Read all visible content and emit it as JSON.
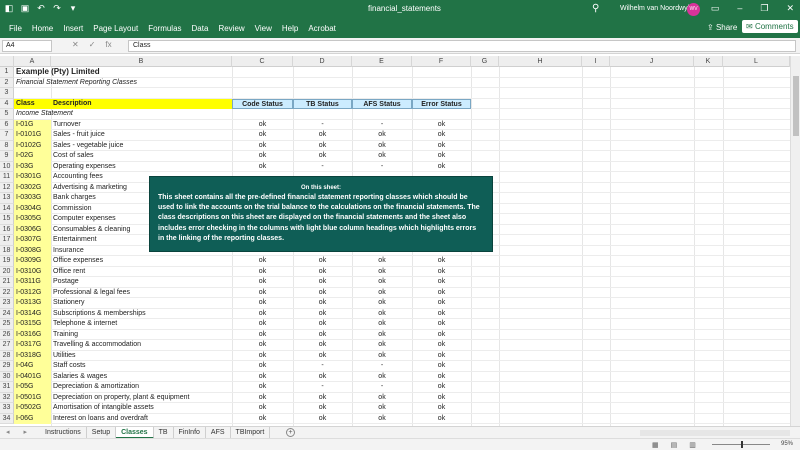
{
  "titlebar": {
    "doc_title": "financial_statements",
    "user_name": "Wilhelm van Noordwyk",
    "avatar_initials": "WV"
  },
  "menu": [
    "File",
    "Home",
    "Insert",
    "Page Layout",
    "Formulas",
    "Data",
    "Review",
    "View",
    "Help",
    "Acrobat"
  ],
  "share_label": "Share",
  "comments_label": "Comments",
  "formula_bar": {
    "name_box": "A4",
    "fx": "fx",
    "content": "Class"
  },
  "columns": [
    "A",
    "B",
    "C",
    "D",
    "E",
    "F",
    "G",
    "H",
    "I",
    "J",
    "K",
    "L"
  ],
  "sheet": {
    "title": "Example (Pty) Limited",
    "subtitle": "Financial Statement Reporting Classes",
    "headers": {
      "class": "Class",
      "description": "Description",
      "code_status": "Code Status",
      "tb_status": "TB Status",
      "afs_status": "AFS Status",
      "error_status": "Error Status"
    },
    "section": "Income Statement",
    "rows": [
      {
        "n": "6",
        "class": "I-01G",
        "desc": "Turnover",
        "c": "ok",
        "d": "-",
        "e": "-",
        "f": "ok"
      },
      {
        "n": "7",
        "class": "I-0101G",
        "desc": "Sales - fruit juice",
        "c": "ok",
        "d": "ok",
        "e": "ok",
        "f": "ok"
      },
      {
        "n": "8",
        "class": "I-0102G",
        "desc": "Sales - vegetable juice",
        "c": "ok",
        "d": "ok",
        "e": "ok",
        "f": "ok"
      },
      {
        "n": "9",
        "class": "I-02G",
        "desc": "Cost of sales",
        "c": "ok",
        "d": "ok",
        "e": "ok",
        "f": "ok"
      },
      {
        "n": "10",
        "class": "I-03G",
        "desc": "Operating expenses",
        "c": "ok",
        "d": "-",
        "e": "-",
        "f": "ok"
      },
      {
        "n": "11",
        "class": "I-0301G",
        "desc": "Accounting fees",
        "c": "",
        "d": "",
        "e": "",
        "f": ""
      },
      {
        "n": "12",
        "class": "I-0302G",
        "desc": "Advertising & marketing",
        "c": "",
        "d": "",
        "e": "",
        "f": ""
      },
      {
        "n": "13",
        "class": "I-0303G",
        "desc": "Bank charges",
        "c": "",
        "d": "",
        "e": "",
        "f": ""
      },
      {
        "n": "14",
        "class": "I-0304G",
        "desc": "Commission",
        "c": "",
        "d": "",
        "e": "",
        "f": ""
      },
      {
        "n": "15",
        "class": "I-0305G",
        "desc": "Computer expenses",
        "c": "",
        "d": "",
        "e": "",
        "f": ""
      },
      {
        "n": "16",
        "class": "I-0306G",
        "desc": "Consumables & cleaning",
        "c": "",
        "d": "",
        "e": "",
        "f": ""
      },
      {
        "n": "17",
        "class": "I-0307G",
        "desc": "Entertainment",
        "c": "",
        "d": "",
        "e": "",
        "f": ""
      },
      {
        "n": "18",
        "class": "I-0308G",
        "desc": "Insurance",
        "c": "",
        "d": "",
        "e": "",
        "f": ""
      },
      {
        "n": "19",
        "class": "I-0309G",
        "desc": "Office expenses",
        "c": "ok",
        "d": "ok",
        "e": "ok",
        "f": "ok"
      },
      {
        "n": "20",
        "class": "I-0310G",
        "desc": "Office rent",
        "c": "ok",
        "d": "ok",
        "e": "ok",
        "f": "ok"
      },
      {
        "n": "21",
        "class": "I-0311G",
        "desc": "Postage",
        "c": "ok",
        "d": "ok",
        "e": "ok",
        "f": "ok"
      },
      {
        "n": "22",
        "class": "I-0312G",
        "desc": "Professional & legal fees",
        "c": "ok",
        "d": "ok",
        "e": "ok",
        "f": "ok"
      },
      {
        "n": "23",
        "class": "I-0313G",
        "desc": "Stationery",
        "c": "ok",
        "d": "ok",
        "e": "ok",
        "f": "ok"
      },
      {
        "n": "24",
        "class": "I-0314G",
        "desc": "Subscriptions & memberships",
        "c": "ok",
        "d": "ok",
        "e": "ok",
        "f": "ok"
      },
      {
        "n": "25",
        "class": "I-0315G",
        "desc": "Telephone & internet",
        "c": "ok",
        "d": "ok",
        "e": "ok",
        "f": "ok"
      },
      {
        "n": "26",
        "class": "I-0316G",
        "desc": "Training",
        "c": "ok",
        "d": "ok",
        "e": "ok",
        "f": "ok"
      },
      {
        "n": "27",
        "class": "I-0317G",
        "desc": "Travelling & accommodation",
        "c": "ok",
        "d": "ok",
        "e": "ok",
        "f": "ok"
      },
      {
        "n": "28",
        "class": "I-0318G",
        "desc": "Utilities",
        "c": "ok",
        "d": "ok",
        "e": "ok",
        "f": "ok"
      },
      {
        "n": "29",
        "class": "I-04G",
        "desc": "Staff costs",
        "c": "ok",
        "d": "-",
        "e": "-",
        "f": "ok"
      },
      {
        "n": "30",
        "class": "I-0401G",
        "desc": "Salaries & wages",
        "c": "ok",
        "d": "ok",
        "e": "ok",
        "f": "ok"
      },
      {
        "n": "31",
        "class": "I-05G",
        "desc": "Depreciation & amortization",
        "c": "ok",
        "d": "-",
        "e": "-",
        "f": "ok"
      },
      {
        "n": "32",
        "class": "I-0501G",
        "desc": "Depreciation on property, plant & equipment",
        "c": "ok",
        "d": "ok",
        "e": "ok",
        "f": "ok"
      },
      {
        "n": "33",
        "class": "I-0502G",
        "desc": "Amortisation of intangible assets",
        "c": "ok",
        "d": "ok",
        "e": "ok",
        "f": "ok"
      },
      {
        "n": "34",
        "class": "I-06G",
        "desc": "Interest on loans and overdraft",
        "c": "ok",
        "d": "ok",
        "e": "ok",
        "f": "ok"
      }
    ]
  },
  "info_box": {
    "title": "On this sheet:",
    "text": "This sheet contains all the pre-defined financial statement reporting classes which should be used to link the accounts on the trial balance to the calculations on the financial statements. The class descriptions on this sheet are displayed on the financial statements and the sheet also includes error checking in the columns with light blue column headings which highlights errors in the linking of the reporting classes."
  },
  "tabs": [
    "Instructions",
    "Setup",
    "Classes",
    "TB",
    "FinInfo",
    "AFS",
    "TBImport"
  ],
  "active_tab": "Classes",
  "status": {
    "zoom": "95%"
  },
  "colors": {
    "excel_green": "#217346",
    "info_box": "#0f5e56",
    "class_yellow": "#ffff99",
    "status_header_blue": "#ccecff"
  }
}
